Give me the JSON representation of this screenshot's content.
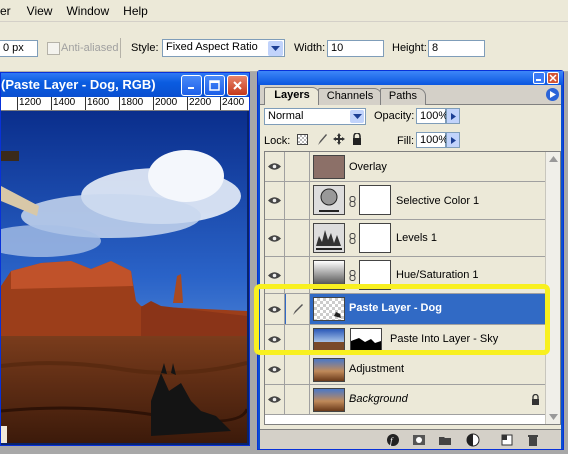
{
  "menu": [
    "er",
    "View",
    "Window",
    "Help"
  ],
  "options": {
    "feather_value": "0 px",
    "anti_aliased_label": "Anti-aliased",
    "style_label": "Style:",
    "style_value": "Fixed Aspect Ratio",
    "width_label": "Width:",
    "width_value": "10",
    "height_label": "Height:",
    "height_value": "8"
  },
  "document": {
    "title": "(Paste Layer - Dog, RGB)",
    "ruler_ticks": [
      "1200",
      "1400",
      "1600",
      "1800",
      "2000",
      "2200",
      "2400"
    ]
  },
  "palette": {
    "tabs": [
      "Layers",
      "Channels",
      "Paths"
    ],
    "blend_mode": "Normal",
    "opacity_label": "Opacity:",
    "opacity_value": "100%",
    "lock_label": "Lock:",
    "fill_label": "Fill:",
    "fill_value": "100%",
    "layers": [
      {
        "name": "Overlay"
      },
      {
        "name": "Selective Color 1"
      },
      {
        "name": "Levels 1"
      },
      {
        "name": "Hue/Saturation 1"
      },
      {
        "name": "Paste Layer - Dog"
      },
      {
        "name": "Paste Into Layer - Sky"
      },
      {
        "name": "Adjustment"
      },
      {
        "name": "Background"
      }
    ]
  },
  "colors": {
    "highlight": "#f8f020",
    "selection": "#316ac5",
    "titlebar": "#0a56e0"
  }
}
